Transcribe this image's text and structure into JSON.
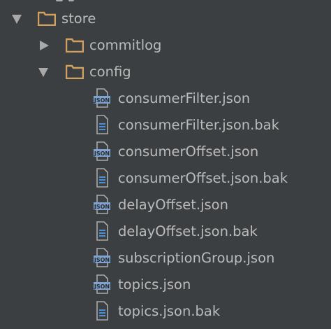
{
  "tree": {
    "store": {
      "label": "store",
      "icon": "folder-icon",
      "expanded": true
    },
    "commitlog": {
      "label": "commitlog",
      "icon": "folder-icon",
      "expanded": false
    },
    "config": {
      "label": "config",
      "icon": "folder-icon",
      "expanded": true,
      "files": [
        {
          "label": "consumerFilter.json",
          "icon": "json-file-icon",
          "badge": "JSON"
        },
        {
          "label": "consumerFilter.json.bak",
          "icon": "text-file-icon"
        },
        {
          "label": "consumerOffset.json",
          "icon": "json-file-icon",
          "badge": "JSON"
        },
        {
          "label": "consumerOffset.json.bak",
          "icon": "text-file-icon"
        },
        {
          "label": "delayOffset.json",
          "icon": "json-file-icon",
          "badge": "JSON"
        },
        {
          "label": "delayOffset.json.bak",
          "icon": "text-file-icon"
        },
        {
          "label": "subscriptionGroup.json",
          "icon": "json-file-icon",
          "badge": "JSON"
        },
        {
          "label": "topics.json",
          "icon": "json-file-icon",
          "badge": "JSON"
        },
        {
          "label": "topics.json.bak",
          "icon": "text-file-icon"
        }
      ]
    }
  },
  "colors": {
    "background": "#3c3f41",
    "text": "#bbbbbb",
    "folder": "#d3a15f",
    "json_badge": "#7ea3d1",
    "file_icon_border": "#a9a9a9",
    "file_icon_lines": "#4a90d9"
  }
}
